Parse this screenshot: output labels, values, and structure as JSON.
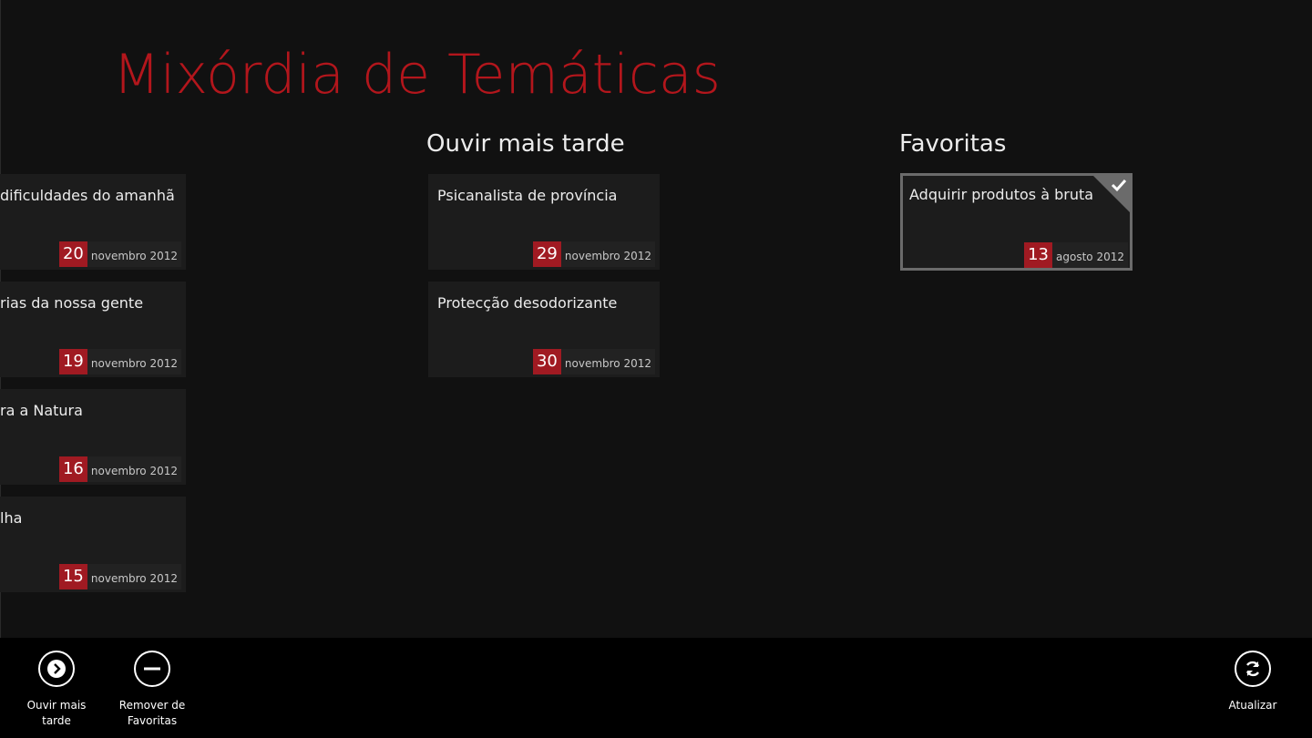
{
  "app": {
    "title": "Mixórdia de Temáticas",
    "accent_color": "#b3161c",
    "date_badge_color": "#a01a22"
  },
  "groups": {
    "first": {
      "items": [
        {
          "title": "dificuldades do amanhã",
          "day": "20",
          "month_year": "novembro 2012"
        },
        {
          "title": "rias da nossa gente",
          "day": "19",
          "month_year": "novembro 2012"
        },
        {
          "title": "ra a Natura",
          "day": "16",
          "month_year": "novembro 2012"
        },
        {
          "title": "lha",
          "day": "15",
          "month_year": "novembro 2012"
        }
      ]
    },
    "listen_later": {
      "header": "Ouvir mais tarde",
      "items": [
        {
          "title": "Psicanalista de província",
          "day": "29",
          "month_year": "novembro 2012"
        },
        {
          "title": "Protecção desodorizante",
          "day": "30",
          "month_year": "novembro 2012"
        }
      ]
    },
    "favorites": {
      "header": "Favoritas",
      "items": [
        {
          "title": "Adquirir produtos à bruta",
          "day": "13",
          "month_year": "agosto 2012",
          "selected": true
        }
      ]
    }
  },
  "appbar": {
    "listen_later_label": "Ouvir mais tarde",
    "remove_favorites_label": "Remover de\nFavoritas",
    "refresh_label": "Atualizar",
    "icons": {
      "listen_later": "chevron-right-circle-icon",
      "remove_favorites": "minus-circle-icon",
      "refresh": "refresh-icon"
    }
  }
}
